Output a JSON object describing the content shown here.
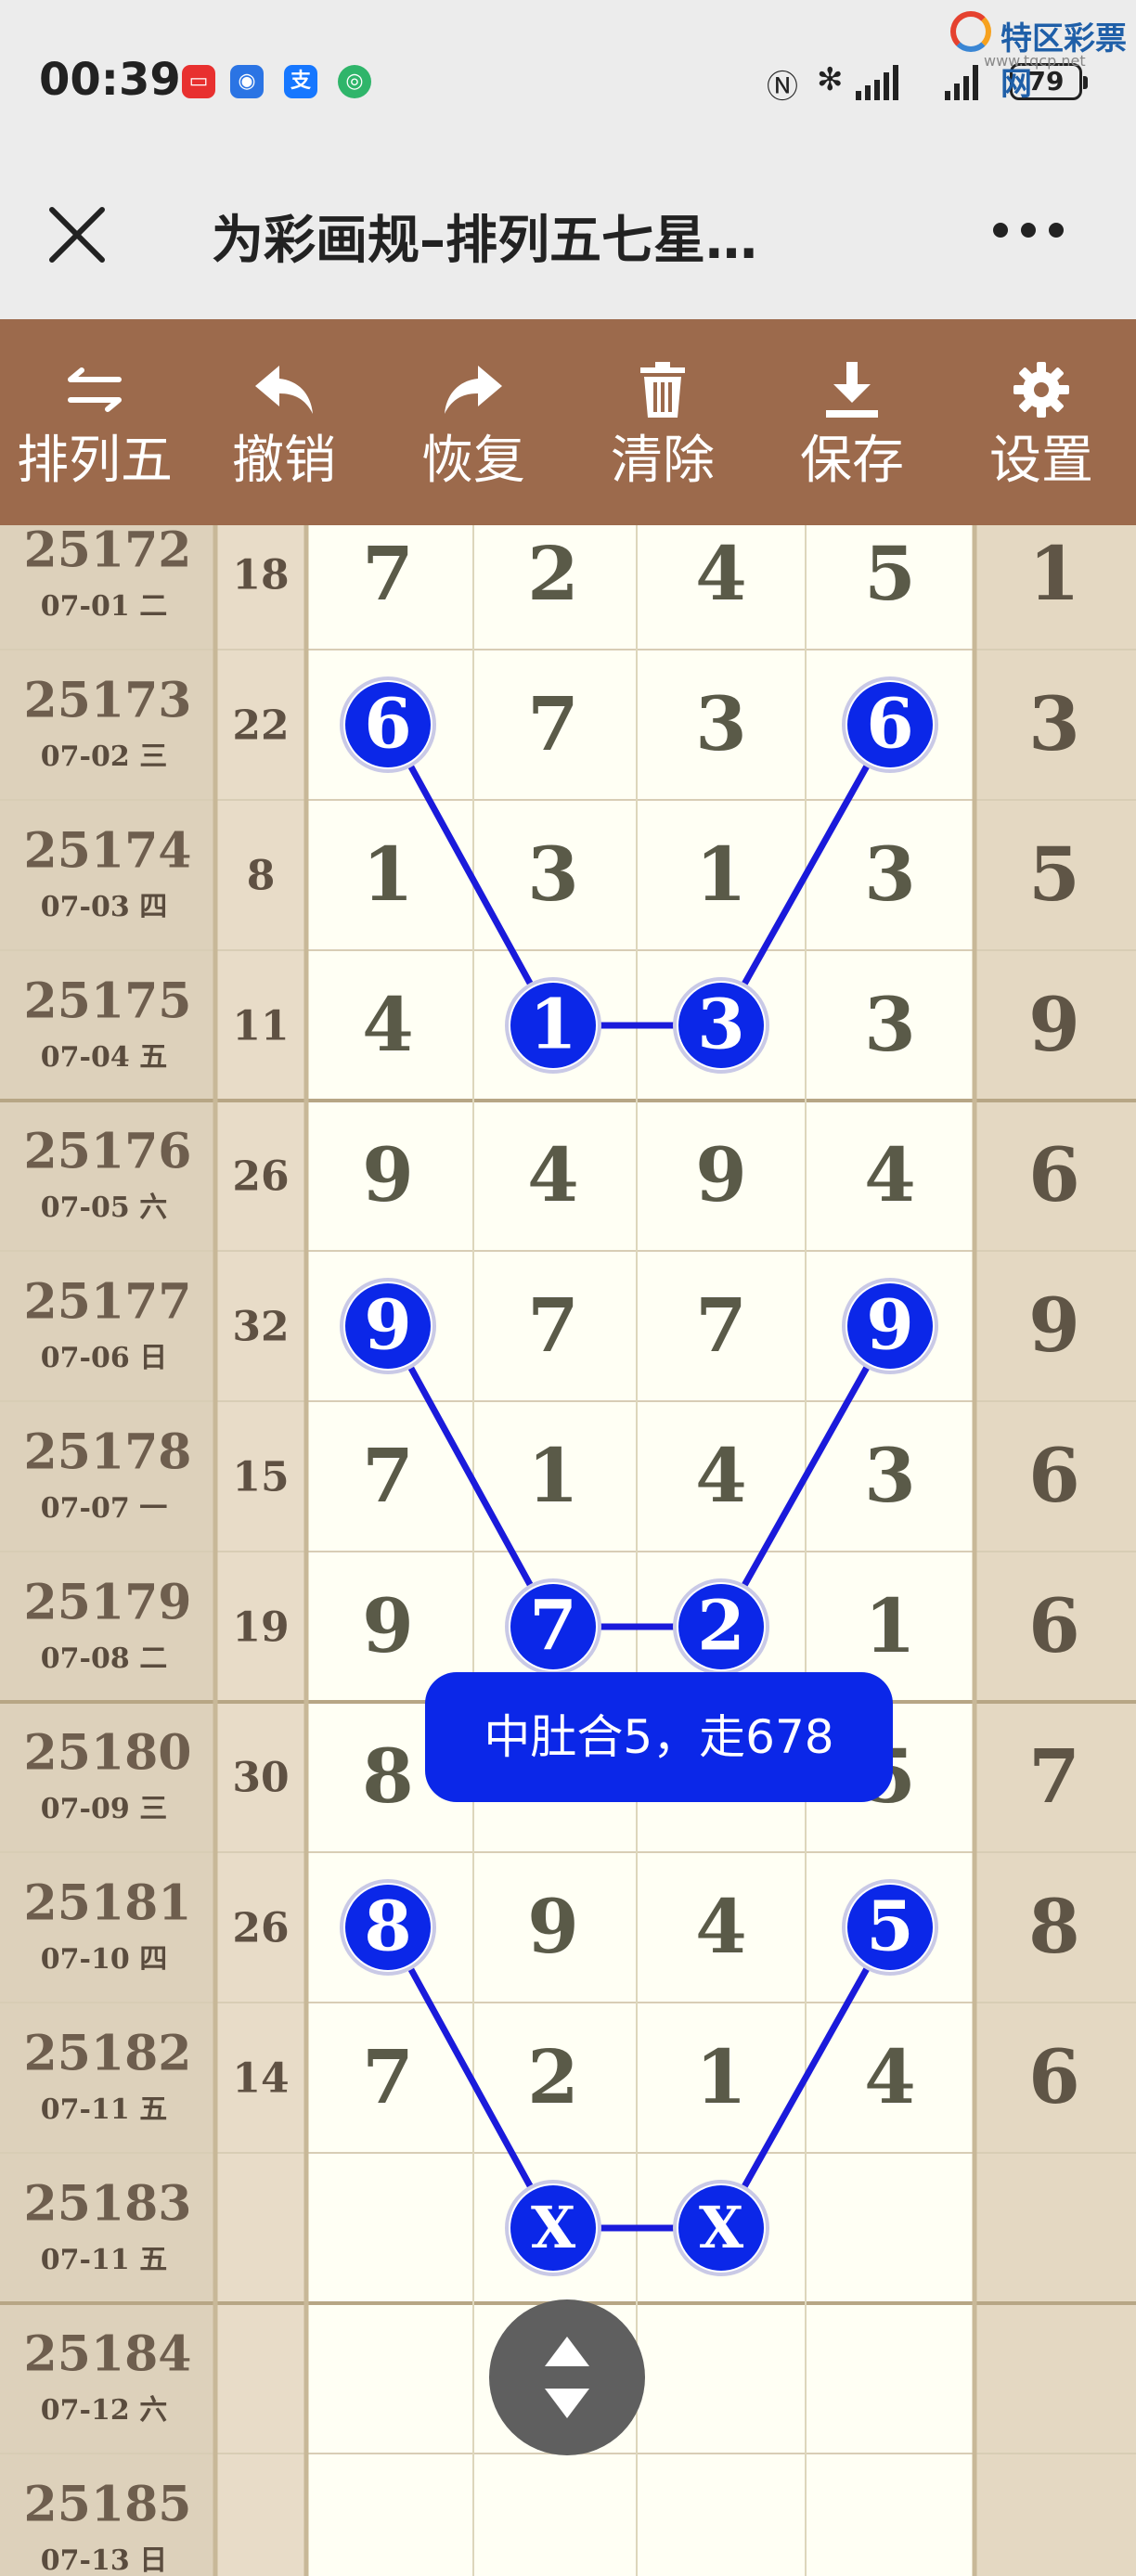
{
  "status_bar": {
    "time": "00:39",
    "battery": "79",
    "icons": [
      "red-app-icon",
      "blue-app-icon",
      "alipay-icon",
      "green-app-icon",
      "nfc-icon",
      "bluetooth-icon",
      "signal-icon",
      "signal-icon"
    ]
  },
  "watermark": {
    "text": "特区彩票网",
    "url": "www.tqcp.net"
  },
  "title_bar": {
    "title": "为彩画规–排列五七星…"
  },
  "toolbar": {
    "items": [
      {
        "label": "排列五",
        "icon": "swap-icon"
      },
      {
        "label": "撤销",
        "icon": "undo-icon"
      },
      {
        "label": "恢复",
        "icon": "redo-icon"
      },
      {
        "label": "清除",
        "icon": "trash-icon"
      },
      {
        "label": "保存",
        "icon": "download-icon"
      },
      {
        "label": "设置",
        "icon": "gear-icon"
      }
    ]
  },
  "rows": [
    {
      "issue": "25172",
      "date": "07-01 二",
      "sum": "18",
      "digits": [
        "7",
        "2",
        "4",
        "5",
        "1"
      ]
    },
    {
      "issue": "25173",
      "date": "07-02 三",
      "sum": "22",
      "digits": [
        "6",
        "7",
        "3",
        "6",
        "3"
      ]
    },
    {
      "issue": "25174",
      "date": "07-03 四",
      "sum": "8",
      "digits": [
        "1",
        "3",
        "1",
        "3",
        "5"
      ]
    },
    {
      "issue": "25175",
      "date": "07-04 五",
      "sum": "11",
      "digits": [
        "4",
        "1",
        "3",
        "3",
        "9"
      ]
    },
    {
      "issue": "25176",
      "date": "07-05 六",
      "sum": "26",
      "digits": [
        "9",
        "4",
        "9",
        "4",
        "6"
      ]
    },
    {
      "issue": "25177",
      "date": "07-06 日",
      "sum": "32",
      "digits": [
        "9",
        "7",
        "7",
        "9",
        "9"
      ]
    },
    {
      "issue": "25178",
      "date": "07-07 一",
      "sum": "15",
      "digits": [
        "7",
        "1",
        "4",
        "3",
        "6"
      ]
    },
    {
      "issue": "25179",
      "date": "07-08 二",
      "sum": "19",
      "digits": [
        "9",
        "7",
        "2",
        "1",
        "6"
      ]
    },
    {
      "issue": "25180",
      "date": "07-09 三",
      "sum": "30",
      "digits": [
        "8",
        "",
        "",
        "5",
        "7"
      ]
    },
    {
      "issue": "25181",
      "date": "07-10 四",
      "sum": "26",
      "digits": [
        "8",
        "9",
        "4",
        "5",
        "8"
      ]
    },
    {
      "issue": "25182",
      "date": "07-11 五",
      "sum": "14",
      "digits": [
        "7",
        "2",
        "1",
        "4",
        "6"
      ]
    },
    {
      "issue": "25183",
      "date": "07-11 五",
      "sum": "",
      "digits": [
        "",
        "X",
        "X",
        "",
        ""
      ]
    },
    {
      "issue": "25184",
      "date": "07-12 六",
      "sum": "",
      "digits": [
        "",
        "",
        "",
        "",
        ""
      ]
    },
    {
      "issue": "25185",
      "date": "07-13 日",
      "sum": "",
      "digits": [
        "",
        "",
        "",
        "",
        ""
      ]
    }
  ],
  "highlights": [
    {
      "row": 1,
      "col": 0
    },
    {
      "row": 1,
      "col": 3
    },
    {
      "row": 3,
      "col": 1
    },
    {
      "row": 3,
      "col": 2
    },
    {
      "row": 5,
      "col": 0
    },
    {
      "row": 5,
      "col": 3
    },
    {
      "row": 7,
      "col": 1
    },
    {
      "row": 7,
      "col": 2
    },
    {
      "row": 9,
      "col": 0
    },
    {
      "row": 9,
      "col": 3
    },
    {
      "row": 11,
      "col": 1
    },
    {
      "row": 11,
      "col": 2
    }
  ],
  "tooltip": {
    "text": "中肚合5，走678"
  },
  "colors": {
    "toolbar": "#9c6a4c",
    "ball": "#0b27e8",
    "line": "#1a1adb",
    "grid_bg": "#fffff4",
    "side_bg": "#ddd1bb"
  }
}
